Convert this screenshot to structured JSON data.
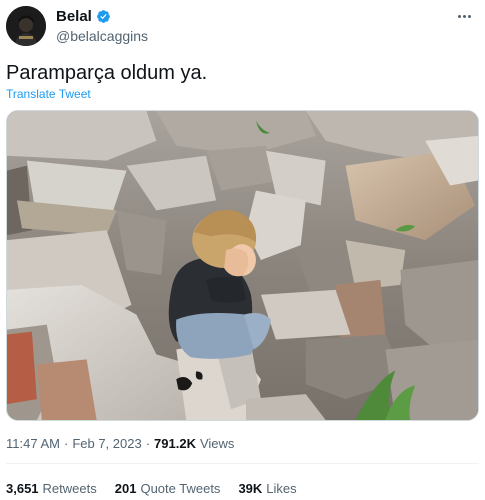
{
  "user": {
    "display_name": "Belal",
    "handle": "@belalcaggins",
    "verified": true
  },
  "tweet": {
    "text": "Paramparça oldum ya.",
    "translate_label": "Translate Tweet",
    "time": "11:47 AM",
    "separator": "·",
    "date": "Feb 7, 2023",
    "views_count": "791.2K",
    "views_label": "Views"
  },
  "stats": [
    {
      "count": "3,651",
      "label": "Retweets"
    },
    {
      "count": "201",
      "label": "Quote Tweets"
    },
    {
      "count": "39K",
      "label": "Likes"
    }
  ],
  "colors": {
    "accent": "#1d9bf0",
    "text_primary": "#0f1419",
    "text_secondary": "#536471"
  },
  "icons": {
    "verified": "verified-badge-icon",
    "more": "more-options-icon"
  }
}
